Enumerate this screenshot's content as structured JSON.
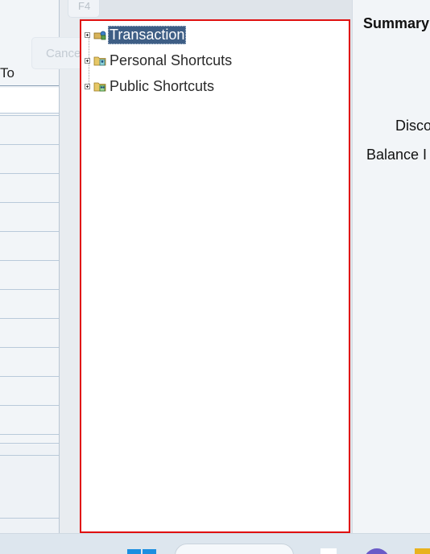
{
  "left_window": {
    "cancel_label": "Cancel",
    "f4_label": "F4",
    "to_label": "To"
  },
  "tree": {
    "nodes": [
      {
        "label": "Transaction",
        "icon": "transaction-folder-icon",
        "selected": true
      },
      {
        "label": "Personal Shortcuts",
        "icon": "personal-shortcuts-folder-icon",
        "selected": false
      },
      {
        "label": "Public Shortcuts",
        "icon": "public-shortcuts-folder-icon",
        "selected": false
      }
    ]
  },
  "summary": {
    "title": "Summary",
    "discount_label": "Disco",
    "balance_label": "Balance I"
  },
  "colors": {
    "focus_border": "#e01010",
    "selection_bg": "#3e5e85",
    "start_blue": "#1c8fe0"
  }
}
